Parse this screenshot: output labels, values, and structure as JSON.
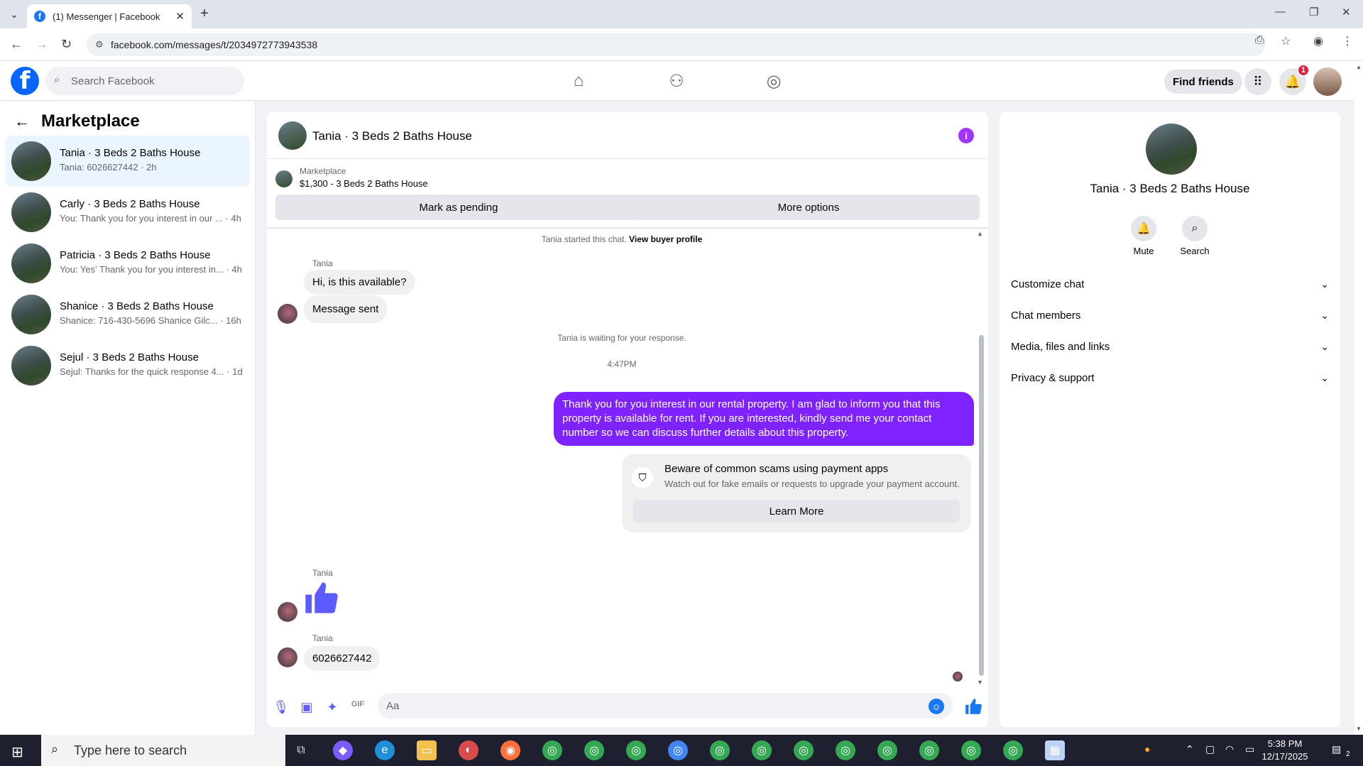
{
  "browser": {
    "tab_title": "(1) Messenger | Facebook",
    "url": "facebook.com/messages/t/2034972773943538",
    "new_tab": "+",
    "tab_close": "✕"
  },
  "header": {
    "search_placeholder": "Search Facebook",
    "find_friends": "Find friends",
    "notification_count": "1"
  },
  "left": {
    "title": "Marketplace",
    "conversations": [
      {
        "name": "Tania · 3 Beds 2 Baths House",
        "snippet": "Tania: 6026627442 · 2h"
      },
      {
        "name": "Carly · 3 Beds 2 Baths House",
        "snippet": "You: Thank you for you interest in our ... · 4h"
      },
      {
        "name": "Patricia · 3 Beds 2 Baths House",
        "snippet": "You: Yes' Thank you for you interest in... · 4h"
      },
      {
        "name": "Shanice · 3 Beds 2 Baths House",
        "snippet": "Shanice: 716-430-5696 Shanice Gilc... · 16h"
      },
      {
        "name": "Sejul · 3 Beds 2 Baths House",
        "snippet": "Sejul: Thanks for the quick response 4... · 1d"
      }
    ]
  },
  "chat": {
    "title": "Tania · 3 Beds 2 Baths House",
    "listing_source": "Marketplace",
    "listing_title": "$1,300 - 3 Beds 2 Baths House",
    "mark_pending": "Mark as pending",
    "more_options": "More options",
    "started": "Tania started this chat.",
    "view_buyer": "View buyer profile",
    "sender": "Tania",
    "msg1": "Hi, is this available?",
    "msg2": "Message sent",
    "waiting": "Tania is waiting for your response.",
    "time": "4:47PM",
    "outgoing": "Thank you for you interest in our rental property. I am glad to inform you that this property is available for rent. If you are interested, kindly send me your contact number so we can discuss further details about this property.",
    "scam_title": "Beware of common scams using payment apps",
    "scam_body": "Watch out for fake emails or requests to upgrade your payment account.",
    "learn_more": "Learn More",
    "phone": "6026627442",
    "composer_placeholder": "Aa"
  },
  "right": {
    "name": "Tania · 3 Beds 2 Baths House",
    "mute": "Mute",
    "search": "Search",
    "sections": [
      "Customize chat",
      "Chat members",
      "Media, files and links",
      "Privacy & support"
    ]
  },
  "taskbar": {
    "search_placeholder": "Type here to search",
    "time": "5:38 PM",
    "date": "12/17/2025",
    "notif_count": "2"
  },
  "colors": {
    "accent": "#7e22ff",
    "fb_blue": "#0866ff",
    "active_bg": "#ebf5ff"
  }
}
